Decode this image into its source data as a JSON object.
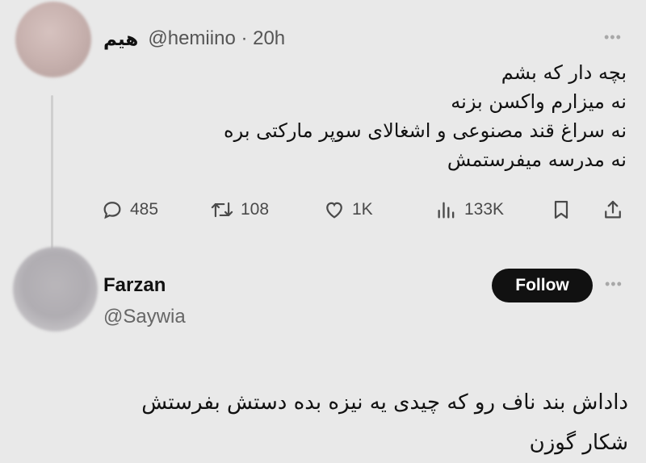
{
  "tweet1": {
    "display_name": "هیم",
    "handle_time": "@hemiino · 20h",
    "lines": [
      "بچه دار که بشم",
      "نه میزارم واکسن بزنه",
      "نه سراغ قند مصنوعی و اشغالای سوپر مارکتی بره",
      "نه مدرسه میفرستمش"
    ],
    "actions": {
      "replies": "485",
      "reposts": "108",
      "likes": "1K",
      "views": "133K"
    }
  },
  "tweet2": {
    "display_name": "Farzan",
    "handle": "@Saywia",
    "follow_label": "Follow",
    "lines": [
      "داداش بند ناف رو که چیدی یه نیزه بده دستش بفرستش",
      "شکار گوزن"
    ]
  },
  "icons": {
    "more": "more-horizontal-icon",
    "reply": "reply-bubble-icon",
    "repost": "repost-arrows-icon",
    "like": "heart-icon",
    "views": "views-bar-chart-icon",
    "bookmark": "bookmark-icon",
    "share": "share-upload-icon"
  },
  "colors": {
    "background": "#e9e9e9",
    "follow_button": "#111111",
    "secondary_text": "#555555"
  }
}
